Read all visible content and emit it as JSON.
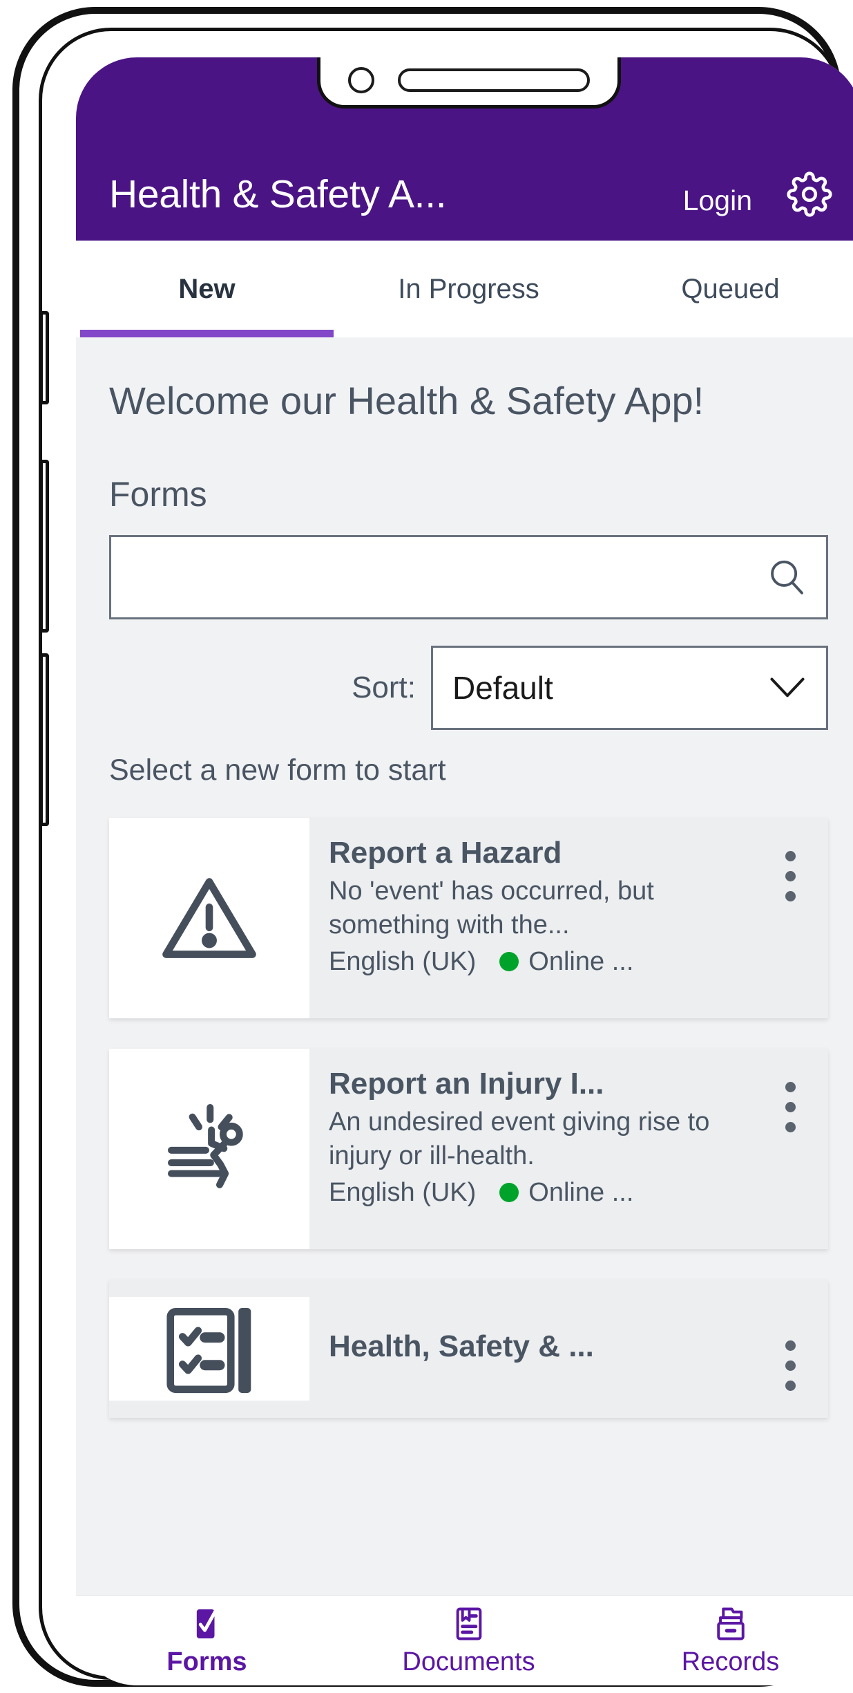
{
  "header": {
    "title": "Health & Safety A...",
    "login_label": "Login",
    "gear_icon": "gear-icon",
    "background_color": "#4B1485"
  },
  "tabs": [
    {
      "label": "New",
      "active": true
    },
    {
      "label": "In Progress",
      "active": false
    },
    {
      "label": "Queued",
      "active": false
    }
  ],
  "main": {
    "welcome_text": "Welcome our Health & Safety App!",
    "forms_heading": "Forms",
    "search": {
      "value": "",
      "placeholder": "",
      "icon": "search-icon"
    },
    "sort": {
      "label": "Sort:",
      "selected": "Default",
      "options": [
        "Default"
      ],
      "icon": "chevron-down-icon"
    },
    "select_hint": "Select a new form to start"
  },
  "form_cards": [
    {
      "icon": "warning-triangle-icon",
      "title": "Report a Hazard",
      "description": "No 'event' has occurred, but something with the...",
      "language": "English (UK)",
      "status": "Online ...",
      "status_color": "#00A32A",
      "menu_icon": "more-vertical-icon"
    },
    {
      "icon": "injury-person-icon",
      "title": "Report an Injury I...",
      "description": "An undesired event giving rise to injury or ill-health.",
      "language": "English (UK)",
      "status": "Online ...",
      "status_color": "#00A32A",
      "menu_icon": "more-vertical-icon"
    },
    {
      "icon": "checklist-clipboard-icon",
      "title": "Health, Safety & ...",
      "description": "",
      "language": "",
      "status": "",
      "status_color": "#00A32A",
      "menu_icon": "more-vertical-icon"
    }
  ],
  "bottom_nav": [
    {
      "label": "Forms",
      "icon": "forms-pen-icon",
      "active": true
    },
    {
      "label": "Documents",
      "icon": "document-icon",
      "active": false
    },
    {
      "label": "Records",
      "icon": "records-folder-icon",
      "active": false
    }
  ],
  "colors": {
    "brand_purple": "#4B1485",
    "accent_purple": "#8246C8",
    "nav_purple": "#5B16A4"
  }
}
